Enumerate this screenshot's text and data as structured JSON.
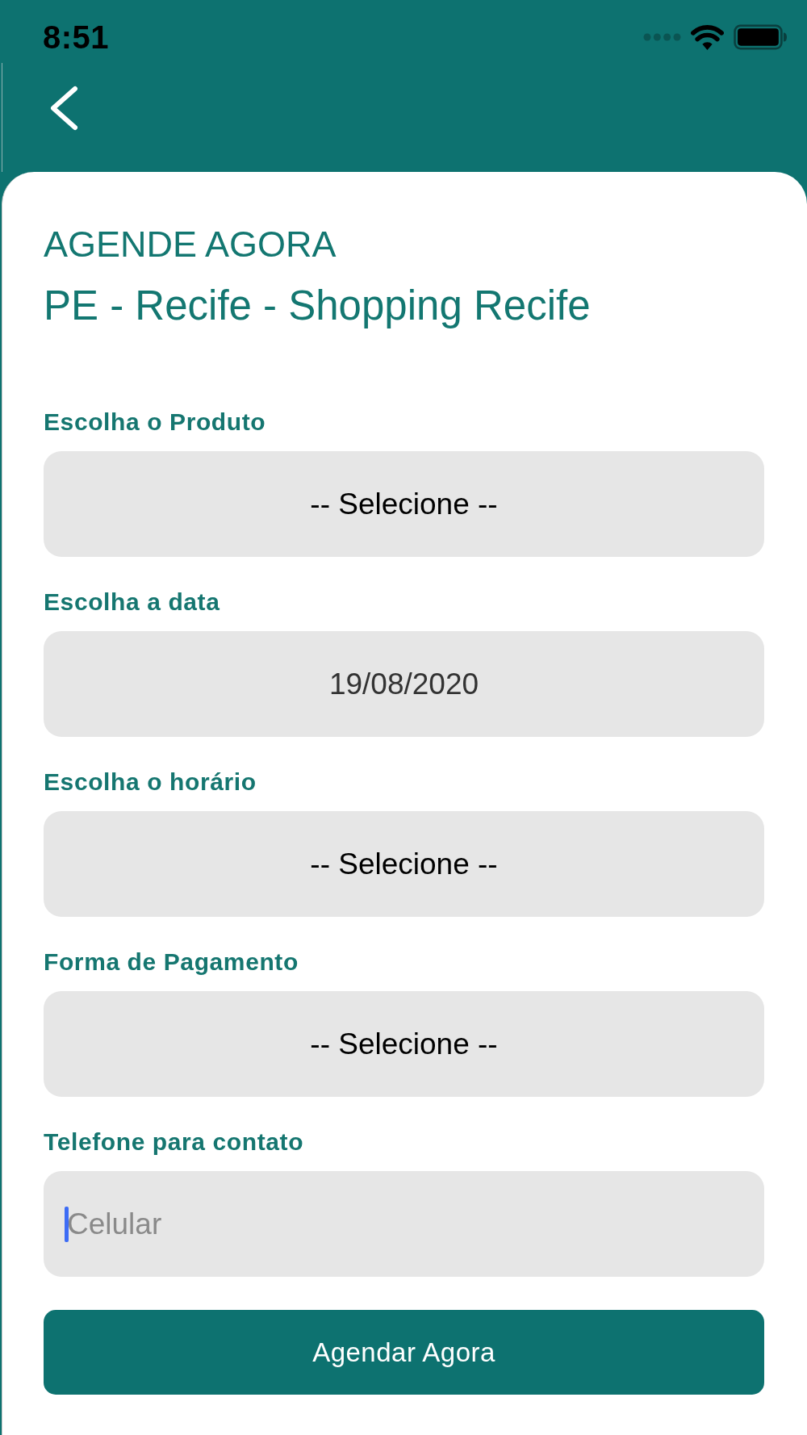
{
  "status_bar": {
    "time": "8:51"
  },
  "title": "AGENDE AGORA",
  "subtitle": "PE - Recife - Shopping Recife",
  "fields": [
    {
      "kind": "select",
      "label": "Escolha o Produto",
      "value": "-- Selecione --"
    },
    {
      "kind": "date",
      "label": "Escolha a data",
      "value": "19/08/2020"
    },
    {
      "kind": "select",
      "label": "Escolha o horário",
      "value": "-- Selecione --"
    },
    {
      "kind": "select",
      "label": "Forma de Pagamento",
      "value": "-- Selecione --"
    },
    {
      "kind": "input",
      "label": "Telefone para contato",
      "placeholder": "Celular",
      "focused": true
    }
  ],
  "submit_button": {
    "label": "Agendar Agora"
  }
}
